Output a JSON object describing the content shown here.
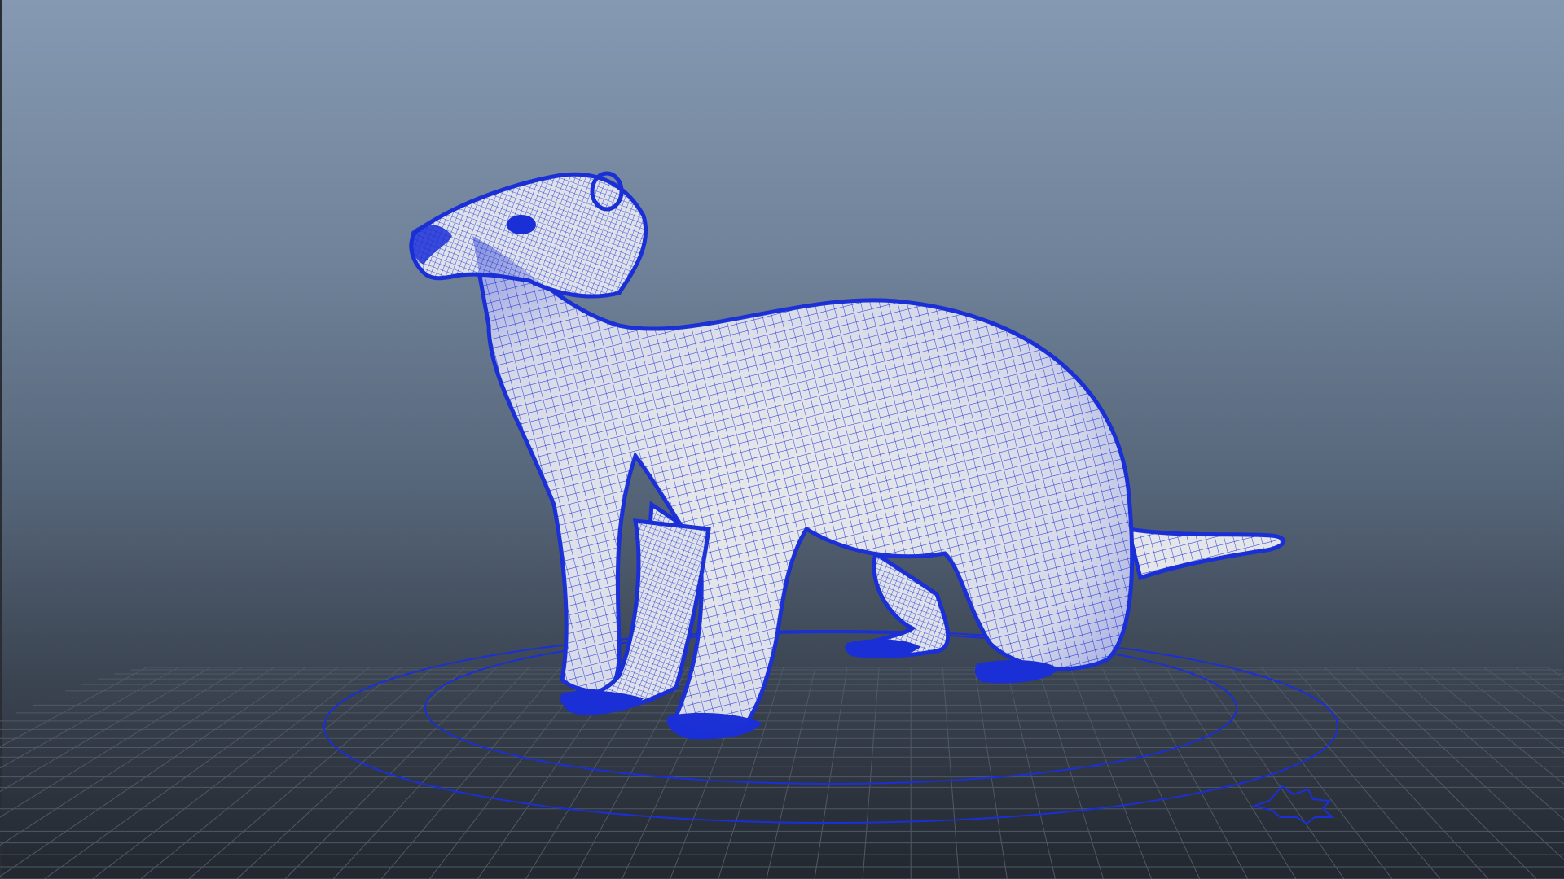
{
  "viewport": {
    "name": "perspective-viewport",
    "background_top": "#8599b2",
    "background_bottom": "#22272f",
    "grid_color": "#505866",
    "wire_color": "#1a2fd6",
    "surface_color": "#e4e6ea",
    "display_mode": "wireframe-on-shaded"
  },
  "scene": {
    "model": "ferret-mesh",
    "ground": "grid",
    "controls": [
      "outer-circle-control",
      "inner-circle-control",
      "star-control"
    ]
  }
}
